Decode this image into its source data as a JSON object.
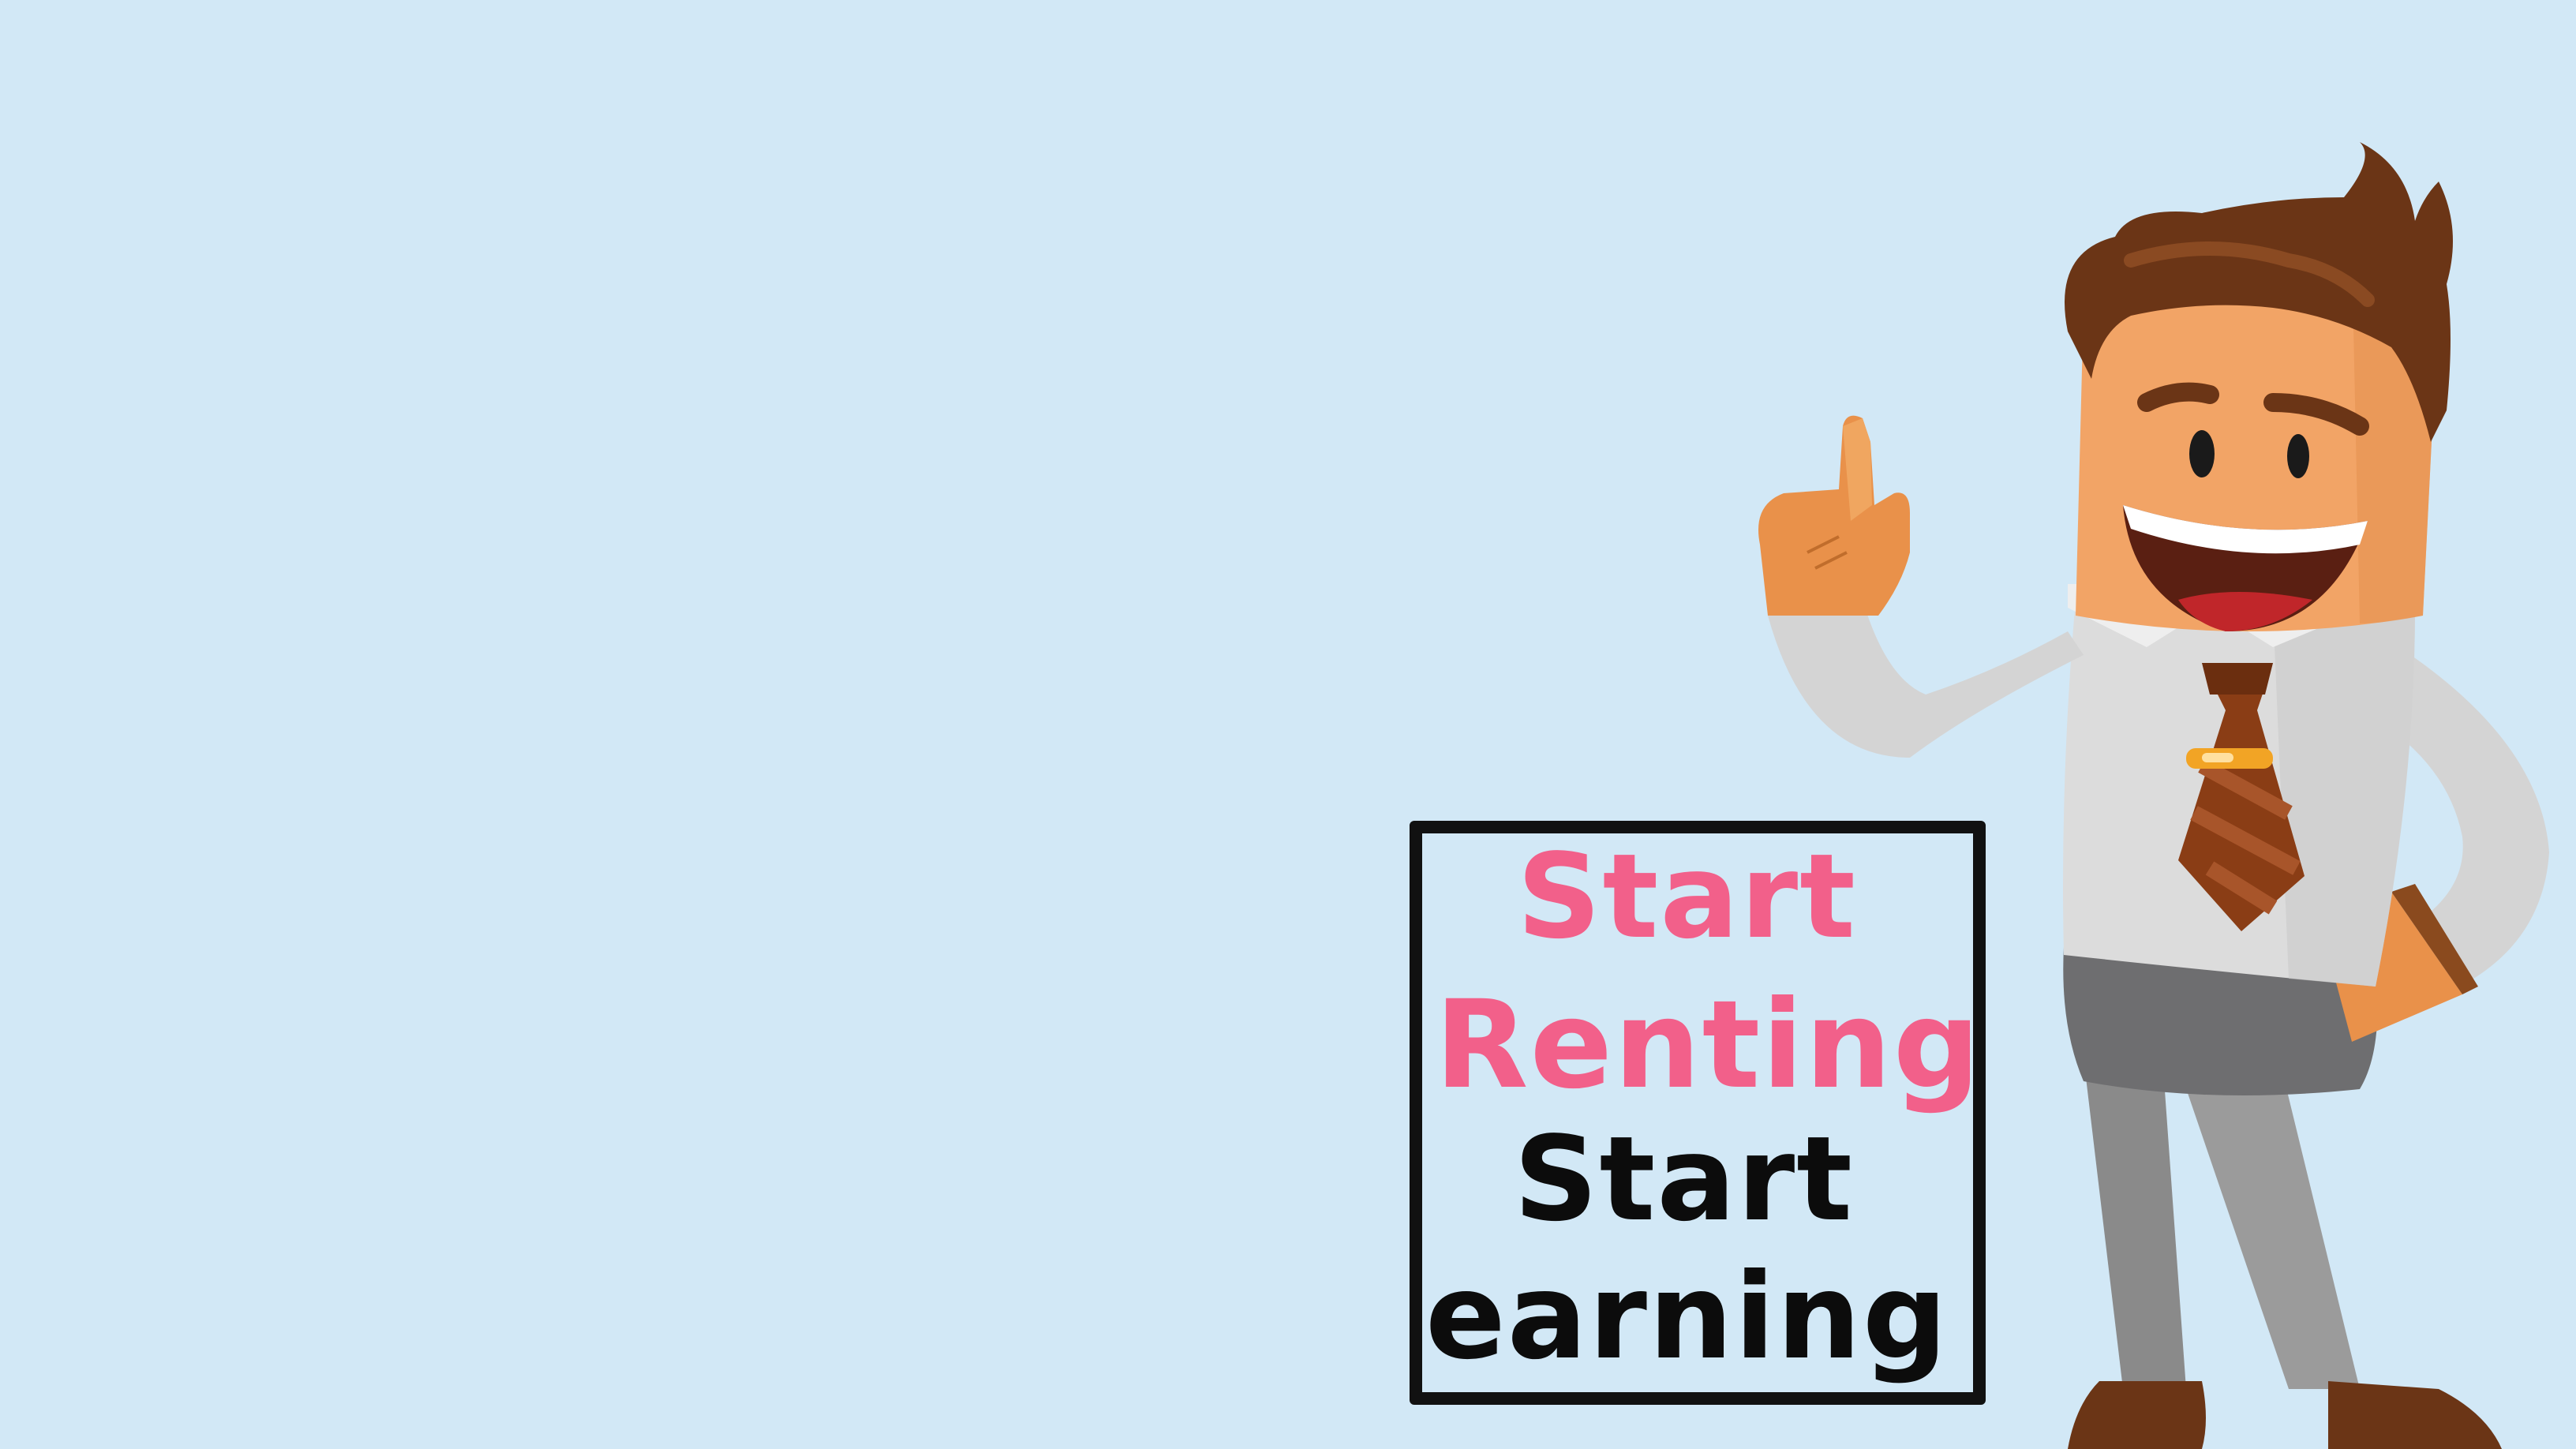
{
  "banner": {
    "line1": "Start",
    "line2": "Renting",
    "line3": "Start",
    "line4": "earning"
  },
  "colors": {
    "background": "#d2e8f6",
    "accent_pink": "#f2608a",
    "text_black": "#0c0c0c",
    "box_border": "#111111"
  },
  "illustration": {
    "subject": "cartoon businessman pointing up",
    "icon": "businessman-illustration"
  }
}
